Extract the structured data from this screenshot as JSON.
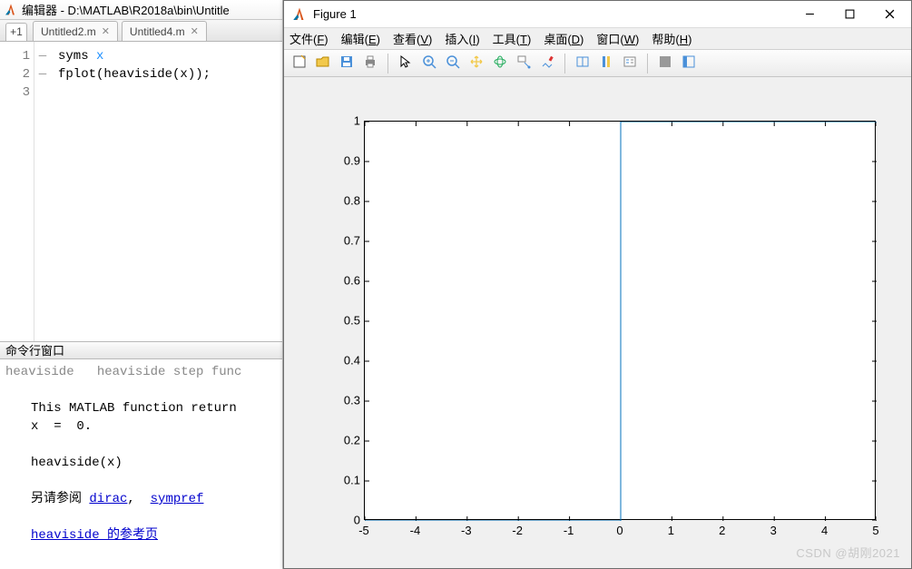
{
  "editor": {
    "title": "编辑器 - D:\\MATLAB\\R2018a\\bin\\Untitle",
    "plus": "+1",
    "tabs": [
      {
        "label": "Untitled2.m"
      },
      {
        "label": "Untitled4.m"
      }
    ],
    "lines": [
      "1",
      "2",
      "3"
    ],
    "code": {
      "l1a": "syms ",
      "l1b": "x",
      "l2": "fplot(heaviside(x));"
    }
  },
  "command": {
    "title": "命令行窗口",
    "trunc": "heaviside   heaviside step func",
    "desc": "This MATLAB function return",
    "xzero": "x  =  0.",
    "hv": "heaviside(x)",
    "seeAlsoPrefix": "另请参阅 ",
    "link1": "dirac",
    "comma": ",  ",
    "link2": "sympref",
    "ref": "heaviside 的参考页"
  },
  "figure": {
    "title": "Figure 1",
    "menus": [
      {
        "t": "文件",
        "k": "F"
      },
      {
        "t": "编辑",
        "k": "E"
      },
      {
        "t": "查看",
        "k": "V"
      },
      {
        "t": "插入",
        "k": "I"
      },
      {
        "t": "工具",
        "k": "T"
      },
      {
        "t": "桌面",
        "k": "D"
      },
      {
        "t": "窗口",
        "k": "W"
      },
      {
        "t": "帮助",
        "k": "H"
      }
    ],
    "toolbar_names": [
      "new-figure",
      "open",
      "save",
      "print",
      "sep",
      "pointer",
      "zoom-in",
      "zoom-out",
      "pan",
      "rotate3d",
      "data-cursor",
      "brush",
      "sep",
      "link",
      "colorbar",
      "legend",
      "sep",
      "hide-tools",
      "dock"
    ]
  },
  "chart_data": {
    "type": "line",
    "title": "",
    "xlabel": "",
    "ylabel": "",
    "xlim": [
      -5,
      5
    ],
    "ylim": [
      0,
      1
    ],
    "x_ticks": [
      -5,
      -4,
      -3,
      -2,
      -1,
      0,
      1,
      2,
      3,
      4,
      5
    ],
    "y_ticks": [
      0,
      0.1,
      0.2,
      0.3,
      0.4,
      0.5,
      0.6,
      0.7,
      0.8,
      0.9,
      1
    ],
    "series": [
      {
        "name": "heaviside(x)",
        "color": "#0072bd",
        "x": [
          -5,
          0,
          0,
          5
        ],
        "y": [
          0,
          0,
          1,
          1
        ]
      }
    ]
  },
  "watermark": "CSDN @胡刚2021"
}
